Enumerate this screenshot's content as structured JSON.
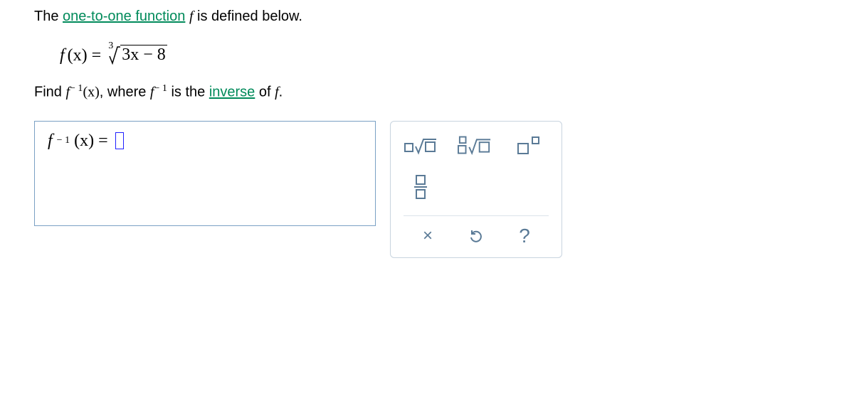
{
  "line1": {
    "prefix": "The ",
    "link": "one-to-one function",
    "mid": " ",
    "fvar": "f",
    "suffix": " is defined below."
  },
  "funcdef": {
    "left": "f",
    "paren": "(x) =",
    "root_index": "3",
    "radicand": "3x − 8"
  },
  "line2": {
    "a": "Find ",
    "b_f": "f",
    "b_exp": "− 1",
    "b_arg": "(x)",
    "c": ", where ",
    "d_f": "f",
    "d_exp": "− 1",
    "e": " is the ",
    "link": "inverse",
    "g": " of ",
    "h_f": "f",
    "i": "."
  },
  "answer": {
    "f": "f",
    "exp": "− 1",
    "arg": "(x)",
    "eq": " = "
  },
  "tools": {
    "sqrt_label": "sqrt",
    "nthroot_label": "nth-root",
    "power_label": "power",
    "fraction_label": "fraction",
    "clear_glyph": "×",
    "undo_glyph": "↺",
    "help_glyph": "?"
  }
}
